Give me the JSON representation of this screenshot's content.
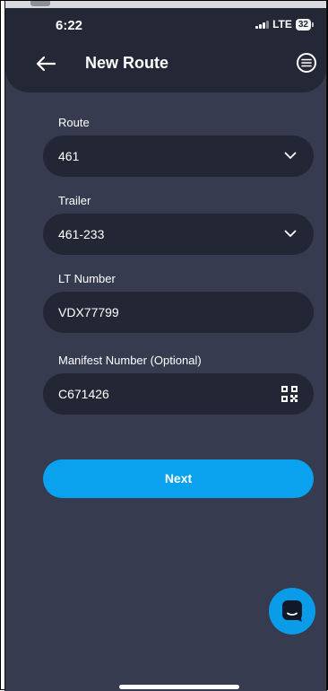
{
  "status_bar": {
    "time": "6:22",
    "network": "LTE",
    "battery": "32"
  },
  "header": {
    "title": "New Route",
    "back_icon": "arrow-left-icon",
    "menu_icon": "hamburger-circle-icon"
  },
  "form": {
    "route": {
      "label": "Route",
      "value": "461"
    },
    "trailer": {
      "label": "Trailer",
      "value": "461-233"
    },
    "lt_number": {
      "label": "LT Number",
      "value": "VDX77799"
    },
    "manifest": {
      "label": "Manifest Number (Optional)",
      "value": "C671426"
    }
  },
  "actions": {
    "next_label": "Next"
  },
  "colors": {
    "background": "#363b50",
    "header": "#242836",
    "field": "#232735",
    "accent": "#0aa2ee"
  }
}
